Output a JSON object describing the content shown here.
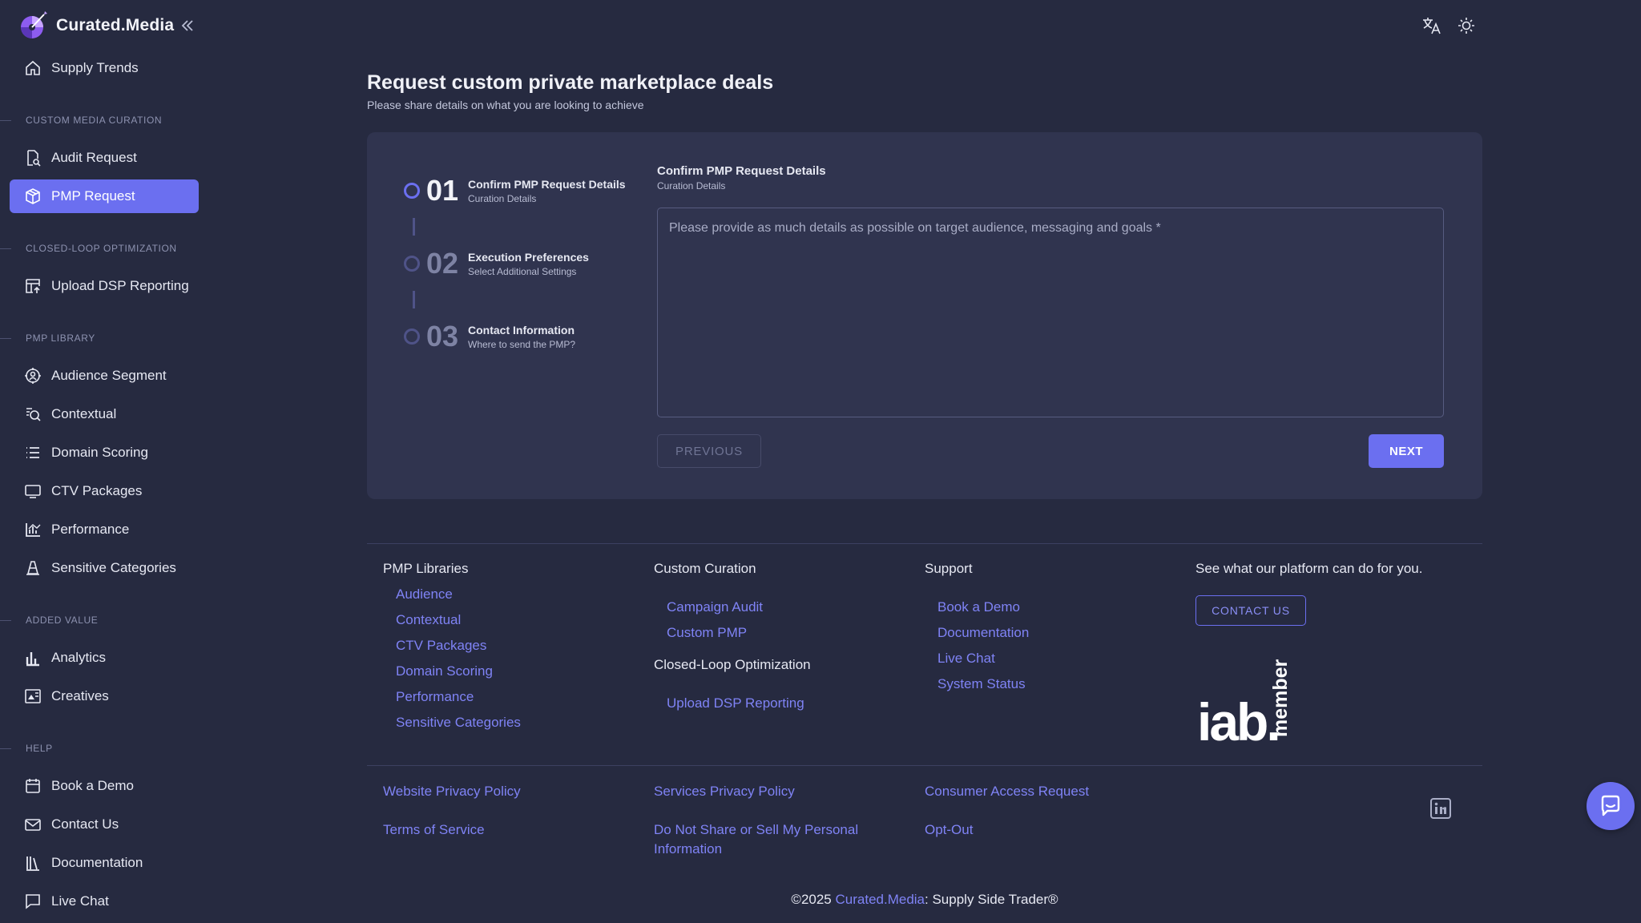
{
  "brand": {
    "name": "Curated.Media",
    "logo_icon": "curated-media-logo"
  },
  "topbar": {
    "translate_icon": "translate-icon",
    "theme_icon": "sun-icon"
  },
  "sidebar": {
    "home": {
      "label": "Supply Trends",
      "icon": "home-icon"
    },
    "sections": {
      "custom": "CUSTOM MEDIA CURATION",
      "closed": "CLOSED-LOOP OPTIMIZATION",
      "library": "PMP LIBRARY",
      "added": "ADDED VALUE",
      "help": "HELP"
    },
    "items": {
      "audit": "Audit Request",
      "pmp": "PMP Request",
      "upload": "Upload DSP Reporting",
      "audience": "Audience Segment",
      "contextual": "Contextual",
      "domain": "Domain Scoring",
      "ctv": "CTV Packages",
      "performance": "Performance",
      "sensitive": "Sensitive Categories",
      "analytics": "Analytics",
      "creatives": "Creatives",
      "demo": "Book a Demo",
      "contact": "Contact Us",
      "docs": "Documentation",
      "chat": "Live Chat"
    }
  },
  "main": {
    "title": "Request custom private marketplace deals",
    "subtitle": "Please share details on what you are looking to achieve",
    "steps": [
      {
        "num": "01",
        "title": "Confirm PMP Request Details",
        "sub": "Curation Details"
      },
      {
        "num": "02",
        "title": "Execution Preferences",
        "sub": "Select Additional Settings"
      },
      {
        "num": "03",
        "title": "Contact Information",
        "sub": "Where to send the PMP?"
      }
    ],
    "form": {
      "title": "Confirm PMP Request Details",
      "sub": "Curation Details",
      "placeholder": "Please provide as much details as possible on target audience, messaging and goals *",
      "prev": "PREVIOUS",
      "next": "NEXT"
    }
  },
  "footer": {
    "col1": {
      "heading": "PMP Libraries",
      "links": [
        "Audience",
        "Contextual",
        "CTV Packages",
        "Domain Scoring",
        "Performance",
        "Sensitive Categories"
      ]
    },
    "col2": {
      "heading": "Custom Curation",
      "links": [
        "Campaign Audit",
        "Custom PMP"
      ],
      "heading2": "Closed-Loop Optimization",
      "links2": [
        "Upload DSP Reporting"
      ]
    },
    "col3": {
      "heading": "Support",
      "links": [
        "Book a Demo",
        "Documentation",
        "Live Chat",
        "System Status"
      ]
    },
    "col4": {
      "heading": "See what our platform can do for you.",
      "contact": "CONTACT US",
      "iab_main": "iab.",
      "iab_member": "member"
    },
    "legal": {
      "website_privacy": "Website Privacy Policy",
      "terms": "Terms of Service",
      "services_privacy": "Services Privacy Policy",
      "do_not_share": "Do Not Share or Sell My Personal Information",
      "consumer_access": "Consumer Access Request",
      "opt_out": "Opt-Out"
    },
    "copyright": {
      "prefix": "©2025 ",
      "brand": "Curated.Media",
      "suffix": ": Supply Side Trader®"
    }
  },
  "colors": {
    "accent": "#6b6ff0",
    "background": "#262a40",
    "card": "#30344f",
    "link": "#7f83f5"
  }
}
